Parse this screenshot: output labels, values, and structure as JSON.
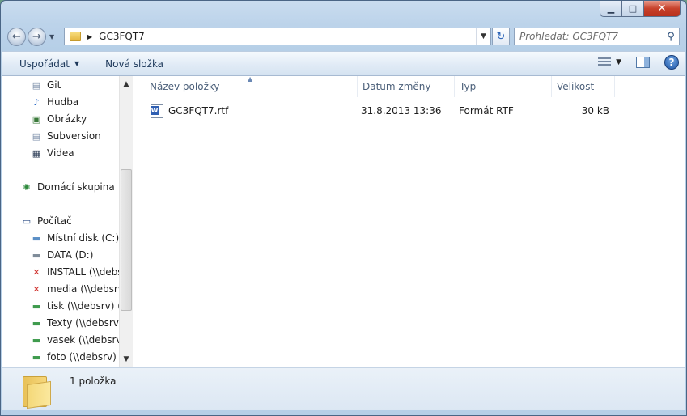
{
  "window": {
    "controls": {
      "minimize": "▁",
      "maximize": "□",
      "close": "✕"
    }
  },
  "navbar": {
    "back_glyph": "←",
    "forward_glyph": "→",
    "current_folder": "GC3FQT7",
    "search_placeholder": "Prohledat: GC3FQT7",
    "refresh_glyph": "↻",
    "search_glyph": "⚲"
  },
  "toolbar": {
    "organize_label": "Uspořádat",
    "new_folder_label": "Nová složka",
    "help_glyph": "?"
  },
  "sidebar": {
    "items": [
      {
        "label": "Git",
        "icon": "git-library-icon",
        "glyph": "▤",
        "color": "#7b8ea8"
      },
      {
        "label": "Hudba",
        "icon": "music-note-icon",
        "glyph": "♪",
        "color": "#2567c5"
      },
      {
        "label": "Obrázky",
        "icon": "pictures-icon",
        "glyph": "▣",
        "color": "#3a7a3a"
      },
      {
        "label": "Subversion",
        "icon": "subversion-library-icon",
        "glyph": "▤",
        "color": "#7b8ea8"
      },
      {
        "label": "Videa",
        "icon": "video-film-icon",
        "glyph": "▦",
        "color": "#2b3b55"
      },
      {
        "label": "Domácí skupina",
        "icon": "homegroup-icon",
        "glyph": "✺",
        "color": "#2f8a3d"
      },
      {
        "label": "Počítač",
        "icon": "computer-icon",
        "glyph": "▭",
        "color": "#2b4d86"
      },
      {
        "label": "Místní disk (C:)",
        "icon": "local-disk-icon",
        "glyph": "▬",
        "color": "#5b8fc6"
      },
      {
        "label": "DATA (D:)",
        "icon": "drive-icon",
        "glyph": "▬",
        "color": "#7f8c99"
      },
      {
        "label": "INSTALL (\\\\debsr",
        "icon": "disconnected-network-drive-icon",
        "glyph": "✕",
        "color": "#d0312d"
      },
      {
        "label": "media (\\\\debsrv)",
        "icon": "disconnected-network-drive-icon",
        "glyph": "✕",
        "color": "#d0312d"
      },
      {
        "label": "tisk (\\\\debsrv) (P:",
        "icon": "network-drive-icon",
        "glyph": "▬",
        "color": "#3f9b4e"
      },
      {
        "label": "Texty (\\\\debsrv) (",
        "icon": "network-drive-icon",
        "glyph": "▬",
        "color": "#3f9b4e"
      },
      {
        "label": "vasek (\\\\debsrv)",
        "icon": "network-drive-icon",
        "glyph": "▬",
        "color": "#3f9b4e"
      },
      {
        "label": "foto (\\\\debsrv) (Z",
        "icon": "network-drive-icon",
        "glyph": "▬",
        "color": "#3f9b4e"
      }
    ]
  },
  "columns": {
    "name": "Název položky",
    "date": "Datum změny",
    "type": "Typ",
    "size": "Velikost"
  },
  "files": [
    {
      "name": "GC3FQT7.rtf",
      "date": "31.8.2013 13:36",
      "type": "Formát RTF",
      "size": "30 kB",
      "icon": "rtf-document-icon"
    }
  ],
  "status": {
    "count_text": "1 položka"
  }
}
